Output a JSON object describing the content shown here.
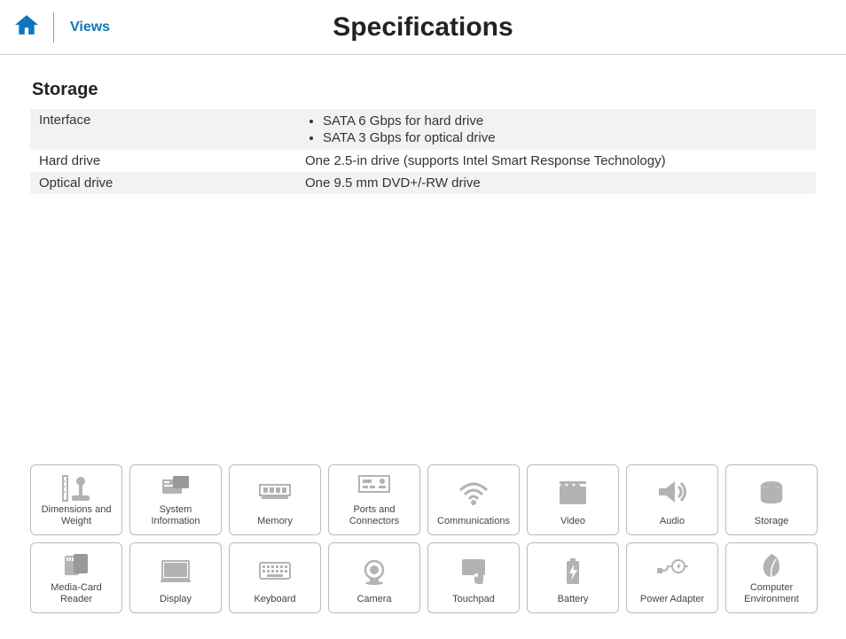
{
  "header": {
    "views_label": "Views",
    "title": "Specifications"
  },
  "section": {
    "title": "Storage",
    "rows": [
      {
        "label": "Interface",
        "items": [
          "SATA 6 Gbps for hard drive",
          "SATA 3 Gbps for optical drive"
        ]
      },
      {
        "label": "Hard drive",
        "value": "One 2.5-in drive (supports Intel Smart Response Technology)"
      },
      {
        "label": "Optical drive",
        "value": "One 9.5 mm DVD+/-RW drive"
      }
    ]
  },
  "tiles": {
    "row1": [
      {
        "label": "Dimensions and Weight",
        "icon": "dimensions"
      },
      {
        "label": "System Information",
        "icon": "system"
      },
      {
        "label": "Memory",
        "icon": "memory"
      },
      {
        "label": "Ports and Connectors",
        "icon": "ports"
      },
      {
        "label": "Communications",
        "icon": "wireless"
      },
      {
        "label": "Video",
        "icon": "video"
      },
      {
        "label": "Audio",
        "icon": "audio"
      },
      {
        "label": "Storage",
        "icon": "storage"
      }
    ],
    "row2": [
      {
        "label": "Media-Card Reader",
        "icon": "mediacard"
      },
      {
        "label": "Display",
        "icon": "display"
      },
      {
        "label": "Keyboard",
        "icon": "keyboard"
      },
      {
        "label": "Camera",
        "icon": "camera"
      },
      {
        "label": "Touchpad",
        "icon": "touchpad"
      },
      {
        "label": "Battery",
        "icon": "battery"
      },
      {
        "label": "Power Adapter",
        "icon": "power"
      },
      {
        "label": "Computer Environment",
        "icon": "environment"
      }
    ]
  }
}
